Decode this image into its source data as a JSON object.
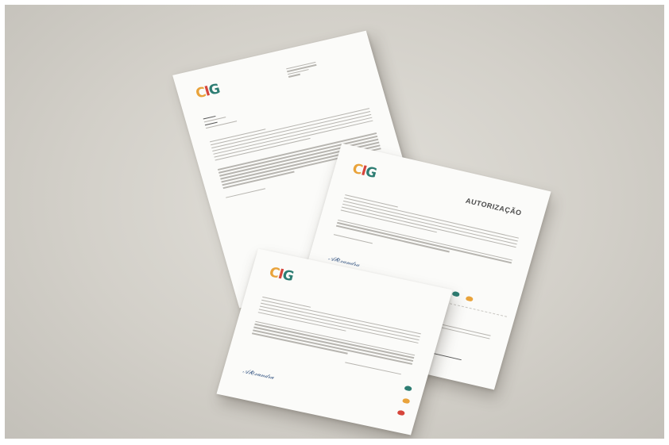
{
  "authorization": {
    "title": "AUTORIZAÇÃO"
  },
  "brand": {
    "logo_mark": "CIG"
  }
}
